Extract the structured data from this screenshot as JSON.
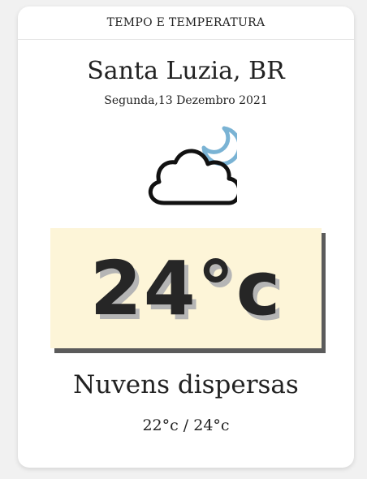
{
  "header": {
    "title": "TEMPO E TEMPERATURA"
  },
  "location": {
    "city": "Santa Luzia, BR"
  },
  "date": {
    "text": "Segunda,13 Dezembro 2021"
  },
  "weather": {
    "icon": "cloud-moon-icon",
    "temperature": "24°c",
    "description": "Nuvens dispersas",
    "min_max": "22°c / 24°c"
  },
  "colors": {
    "temp_box_background": "#fdf5d8",
    "moon": "#7ab3d4",
    "cloud_stroke": "#111111",
    "text": "#222222"
  }
}
